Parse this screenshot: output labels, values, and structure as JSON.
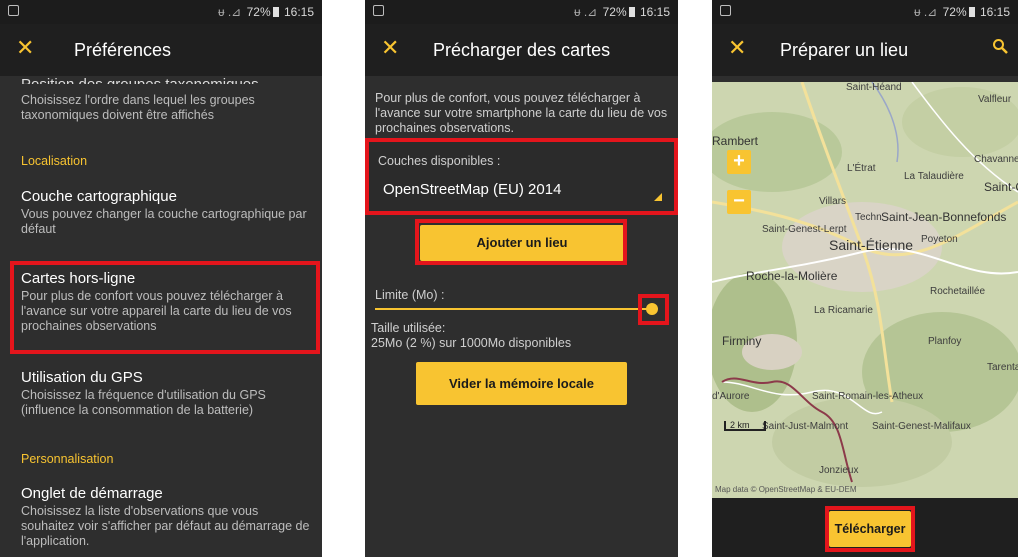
{
  "status": {
    "indicators": "ᵾ .⊿",
    "battery": "72%",
    "time": "16:15"
  },
  "panel1": {
    "title": "Préférences",
    "clipped_item_title": "Position des groupes taxonomiques",
    "group_order": {
      "desc": "Choisissez l'ordre dans lequel les groupes taxonomiques doivent être affichés"
    },
    "section_localisation": "Localisation",
    "map_layer": {
      "title": "Couche cartographique",
      "desc": "Vous pouvez changer la couche cartographique par défaut"
    },
    "offline_maps": {
      "title": "Cartes hors-ligne",
      "desc": "Pour plus de confort vous pouvez télécharger à l'avance sur votre appareil la carte du lieu de vos prochaines observations"
    },
    "gps": {
      "title": "Utilisation du GPS",
      "desc": "Choisissez la fréquence d'utilisation du GPS (influence la consommation de la batterie)"
    },
    "section_personnalisation": "Personnalisation",
    "start_tab": {
      "title": "Onglet de démarrage",
      "desc": "Choisissez la liste d'observations que vous souhaitez voir s'afficher par défaut au démarrage de l'application."
    }
  },
  "panel2": {
    "title": "Précharger des cartes",
    "intro": "Pour plus de confort, vous pouvez télécharger à l'avance sur votre smartphone la carte du lieu de vos prochaines observations.",
    "layers_label": "Couches disponibles :",
    "layer_value": "OpenStreetMap (EU) 2014",
    "add_place_button": "Ajouter un lieu",
    "limit_label": "Limite (Mo) :",
    "limit_fraction": 1.0,
    "used_label": "Taille utilisée:",
    "used_value": "25Mo (2 %) sur 1000Mo disponibles",
    "clear_cache_button": "Vider la mémoire locale"
  },
  "panel3": {
    "title": "Préparer un lieu",
    "download_button": "Télécharger",
    "zoom_in": "+",
    "zoom_out": "−",
    "scale": "2 km",
    "attribution": "Map data © OpenStreetMap & EU-DEM",
    "places": {
      "saint_heand": "Saint-Héand",
      "valfleury": "Valfleur",
      "rambert": "Rambert",
      "etrat": "L'Étrat",
      "talaudiere": "La Talaudière",
      "chavanne": "Chavanne",
      "saint_c": "Saint-C",
      "villars": "Villars",
      "saint_genest_lerpt": "Saint-Genest-Lerpt",
      "techn": "Techn",
      "saint_jean_bonnefonds": "Saint-Jean-Bonnefonds",
      "saint_etienne": "Saint-Étienne",
      "roche_la_moliere": "Roche-la-Molière",
      "rochetaillee": "Rochetaillée",
      "la_ricamarie": "La Ricamarie",
      "firminy": "Firminy",
      "planfoy": "Planfoy",
      "tarentaise": "Tarentais",
      "saint_romain": "Saint-Romain-les-Atheux",
      "saint_just_malmont": "Saint-Just-Malmont",
      "saint_genest_malifaux": "Saint-Genest-Malifaux",
      "jonzieux": "Jonzieux",
      "aurore": "d'Aurore",
      "poyeton": "Poyeton"
    }
  },
  "colors": {
    "accent": "#f8c431",
    "highlight": "#e4151c",
    "background": "#2e2e2e",
    "appbar": "#1f1f1f"
  }
}
